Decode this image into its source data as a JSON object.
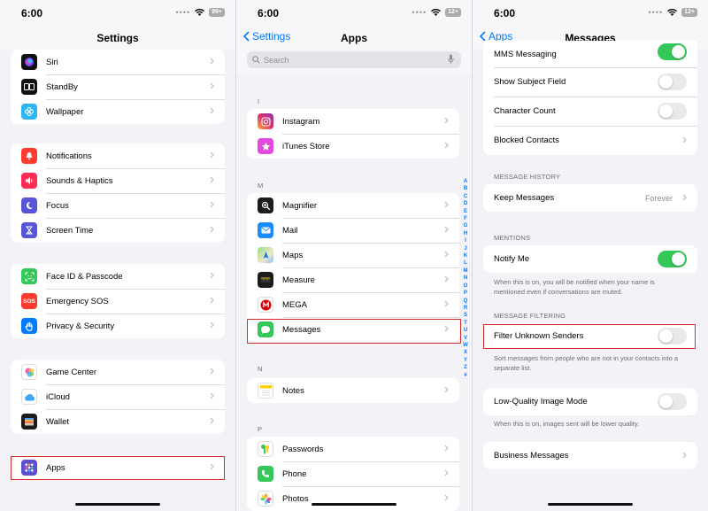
{
  "status": {
    "time": "6:00",
    "battery": [
      "99+",
      "12+",
      "12+"
    ]
  },
  "panel1": {
    "title": "Settings",
    "groups": [
      [
        {
          "label": "Siri"
        },
        {
          "label": "StandBy"
        },
        {
          "label": "Wallpaper"
        }
      ],
      [
        {
          "label": "Notifications"
        },
        {
          "label": "Sounds & Haptics"
        },
        {
          "label": "Focus"
        },
        {
          "label": "Screen Time"
        }
      ],
      [
        {
          "label": "Face ID & Passcode"
        },
        {
          "label": "Emergency SOS"
        },
        {
          "label": "Privacy & Security"
        }
      ],
      [
        {
          "label": "Game Center"
        },
        {
          "label": "iCloud"
        },
        {
          "label": "Wallet"
        }
      ],
      [
        {
          "label": "Apps"
        }
      ]
    ],
    "sos_text": "SOS"
  },
  "panel2": {
    "back": "Settings",
    "title": "Apps",
    "search_placeholder": "Search",
    "sections": [
      {
        "letter": "I",
        "items": [
          {
            "label": "Instagram"
          },
          {
            "label": "iTunes Store"
          }
        ]
      },
      {
        "letter": "M",
        "items": [
          {
            "label": "Magnifier"
          },
          {
            "label": "Mail"
          },
          {
            "label": "Maps"
          },
          {
            "label": "Measure"
          },
          {
            "label": "MEGA"
          },
          {
            "label": "Messages"
          }
        ]
      },
      {
        "letter": "N",
        "items": [
          {
            "label": "Notes"
          }
        ]
      },
      {
        "letter": "P",
        "items": [
          {
            "label": "Passwords"
          },
          {
            "label": "Phone"
          },
          {
            "label": "Photos"
          }
        ]
      }
    ],
    "index": [
      "A",
      "B",
      "C",
      "D",
      "E",
      "F",
      "G",
      "H",
      "I",
      "J",
      "K",
      "L",
      "M",
      "N",
      "O",
      "P",
      "Q",
      "R",
      "S",
      "T",
      "U",
      "V",
      "W",
      "X",
      "Y",
      "Z",
      "#"
    ]
  },
  "panel3": {
    "back": "Apps",
    "title": "Messages",
    "top_rows": [
      {
        "label": "MMS Messaging",
        "toggle": true
      },
      {
        "label": "Show Subject Field",
        "toggle": false
      },
      {
        "label": "Character Count",
        "toggle": false
      },
      {
        "label": "Blocked Contacts"
      }
    ],
    "history_header": "MESSAGE HISTORY",
    "keep_messages": {
      "label": "Keep Messages",
      "value": "Forever"
    },
    "mentions_header": "MENTIONS",
    "notify_me": {
      "label": "Notify Me",
      "toggle": true
    },
    "notify_note": "When this is on, you will be notified when your name is mentioned even if conversations are muted.",
    "filtering_header": "MESSAGE FILTERING",
    "filter_unknown": {
      "label": "Filter Unknown Senders",
      "toggle": false
    },
    "filter_note": "Sort messages from people who are not in your contacts into a separate list.",
    "low_quality": {
      "label": "Low-Quality Image Mode",
      "toggle": false
    },
    "low_quality_note": "When this is on, images sent will be lower quality.",
    "business": {
      "label": "Business Messages"
    }
  },
  "colors": {
    "accent": "#007aff",
    "toggle_on": "#34c759",
    "highlight": "#d62828",
    "background": "#f2f2f7"
  }
}
